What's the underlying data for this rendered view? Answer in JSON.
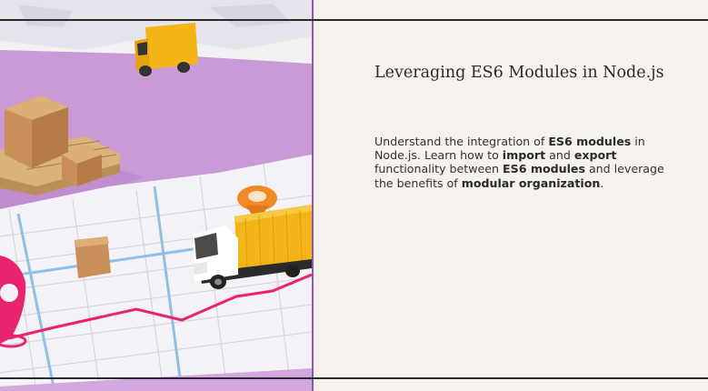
{
  "slide": {
    "title": "Leveraging ES6 Modules in Node.js",
    "body_parts": [
      {
        "text": "Understand the integration of ",
        "bold": false
      },
      {
        "text": "ES6 modules",
        "bold": true
      },
      {
        "text": " in Node.js. Learn how to ",
        "bold": false
      },
      {
        "text": "import",
        "bold": true
      },
      {
        "text": " and ",
        "bold": false
      },
      {
        "text": "export",
        "bold": true
      },
      {
        "text": " functionality between ",
        "bold": false
      },
      {
        "text": "ES6 modules",
        "bold": true
      },
      {
        "text": " and leverage the benefits of ",
        "bold": false
      },
      {
        "text": "modular organization",
        "bold": true
      },
      {
        "text": ".",
        "bold": false
      }
    ]
  },
  "image": {
    "subject": "toy delivery trucks, cardboard boxes on a pallet and a location pin on a street map",
    "colors": {
      "map": "#f3f0f4",
      "table": "#c99ad6",
      "route": "#e8246e",
      "truck_cargo": "#f2b416",
      "box": "#c98f58",
      "pin_orange": "#f08a24"
    }
  },
  "theme": {
    "background": "#f5f2ed",
    "rule": "#2a2a2a",
    "divider": "#8a5aa8"
  }
}
